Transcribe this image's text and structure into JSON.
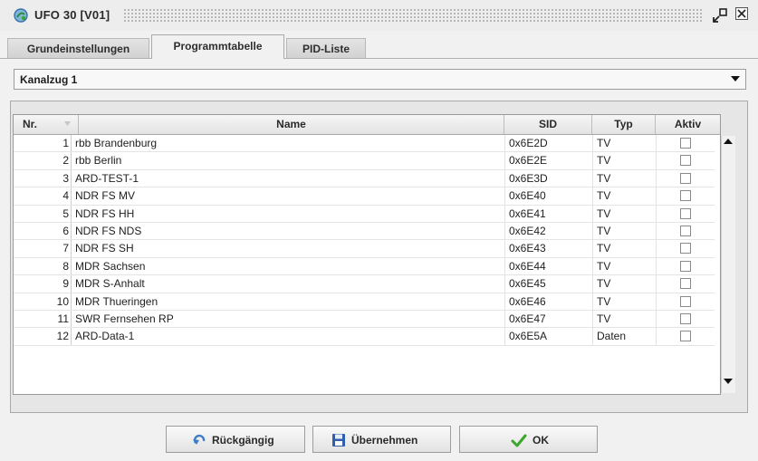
{
  "window": {
    "title": "UFO 30 [V01]",
    "accent_color": "#3a6fb0"
  },
  "tabs": [
    {
      "label": "Grundeinstellungen",
      "active": false
    },
    {
      "label": "Programmtabelle",
      "active": true
    },
    {
      "label": "PID-Liste",
      "active": false
    }
  ],
  "channel_select": {
    "value": "Kanalzug 1"
  },
  "table": {
    "columns": {
      "nr": "Nr.",
      "name": "Name",
      "sid": "SID",
      "typ": "Typ",
      "aktiv": "Aktiv"
    },
    "rows": [
      {
        "nr": "1",
        "name": "rbb Brandenburg",
        "sid": "0x6E2D",
        "typ": "TV",
        "aktiv": false
      },
      {
        "nr": "2",
        "name": "rbb Berlin",
        "sid": "0x6E2E",
        "typ": "TV",
        "aktiv": false
      },
      {
        "nr": "3",
        "name": "ARD-TEST-1",
        "sid": "0x6E3D",
        "typ": "TV",
        "aktiv": false
      },
      {
        "nr": "4",
        "name": "NDR FS MV",
        "sid": "0x6E40",
        "typ": "TV",
        "aktiv": false
      },
      {
        "nr": "5",
        "name": "NDR FS HH",
        "sid": "0x6E41",
        "typ": "TV",
        "aktiv": false
      },
      {
        "nr": "6",
        "name": "NDR FS NDS",
        "sid": "0x6E42",
        "typ": "TV",
        "aktiv": false
      },
      {
        "nr": "7",
        "name": "NDR FS SH",
        "sid": "0x6E43",
        "typ": "TV",
        "aktiv": false
      },
      {
        "nr": "8",
        "name": "MDR Sachsen",
        "sid": "0x6E44",
        "typ": "TV",
        "aktiv": false
      },
      {
        "nr": "9",
        "name": "MDR S-Anhalt",
        "sid": "0x6E45",
        "typ": "TV",
        "aktiv": false
      },
      {
        "nr": "10",
        "name": "MDR Thueringen",
        "sid": "0x6E46",
        "typ": "TV",
        "aktiv": false
      },
      {
        "nr": "11",
        "name": "SWR Fernsehen RP",
        "sid": "0x6E47",
        "typ": "TV",
        "aktiv": false
      },
      {
        "nr": "12",
        "name": "ARD-Data-1",
        "sid": "0x6E5A",
        "typ": "Daten",
        "aktiv": false
      }
    ]
  },
  "buttons": {
    "undo": "Rückgängig",
    "apply": "Übernehmen",
    "ok": "OK"
  },
  "icons": {
    "app": "app-window-icon",
    "restore": "restore-window-icon",
    "close": "close-window-icon",
    "undo": "undo-arrow-icon",
    "apply": "floppy-disk-icon",
    "ok": "checkmark-icon"
  },
  "colors": {
    "ok_check": "#3aa62c",
    "floppy": "#2f5fae",
    "undo_arrow": "#3f7ec4"
  }
}
